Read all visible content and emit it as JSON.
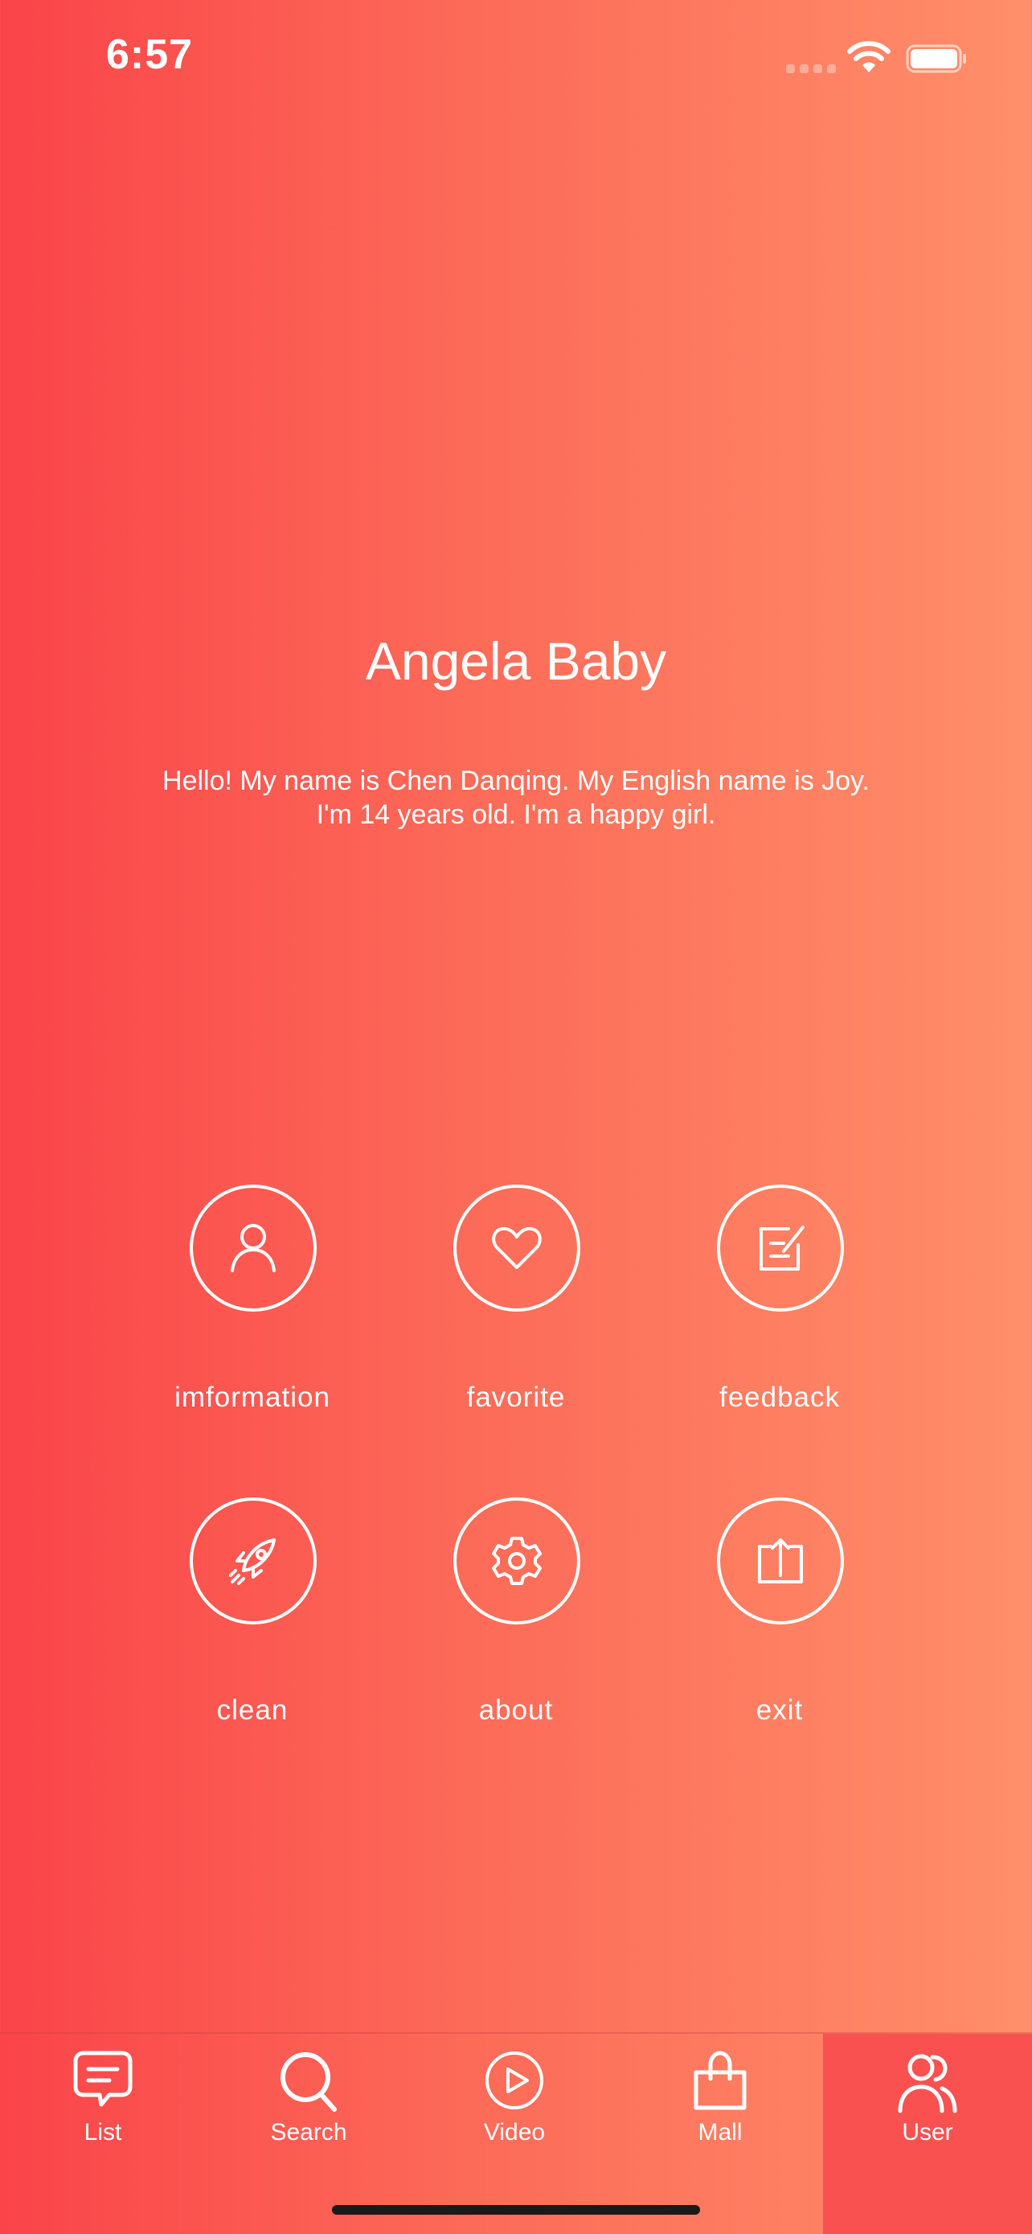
{
  "status_bar": {
    "time": "6:57"
  },
  "profile": {
    "name": "Angela Baby",
    "bio_lines": [
      "Hello! My name is Chen Danqing. My English name is Joy.",
      "I'm 14 years old. I'm a happy girl."
    ]
  },
  "actions": [
    {
      "label": "imformation",
      "icon": "person-icon"
    },
    {
      "label": "favorite",
      "icon": "heart-icon"
    },
    {
      "label": "feedback",
      "icon": "edit-note-icon"
    },
    {
      "label": "clean",
      "icon": "rocket-icon"
    },
    {
      "label": "about",
      "icon": "gear-icon"
    },
    {
      "label": "exit",
      "icon": "share-upload-icon"
    }
  ],
  "tab_bar": {
    "active": "User",
    "tabs": [
      {
        "label": "List",
        "icon": "chat-list-icon"
      },
      {
        "label": "Search",
        "icon": "search-icon"
      },
      {
        "label": "Video",
        "icon": "play-circle-icon"
      },
      {
        "label": "Mall",
        "icon": "shopping-bag-icon"
      },
      {
        "label": "User",
        "icon": "users-icon"
      }
    ]
  },
  "colors": {
    "gradient_start": "#fa4449",
    "gradient_end": "#ff8f6a",
    "active_tab": "#f95150",
    "foreground": "#ffffff"
  }
}
